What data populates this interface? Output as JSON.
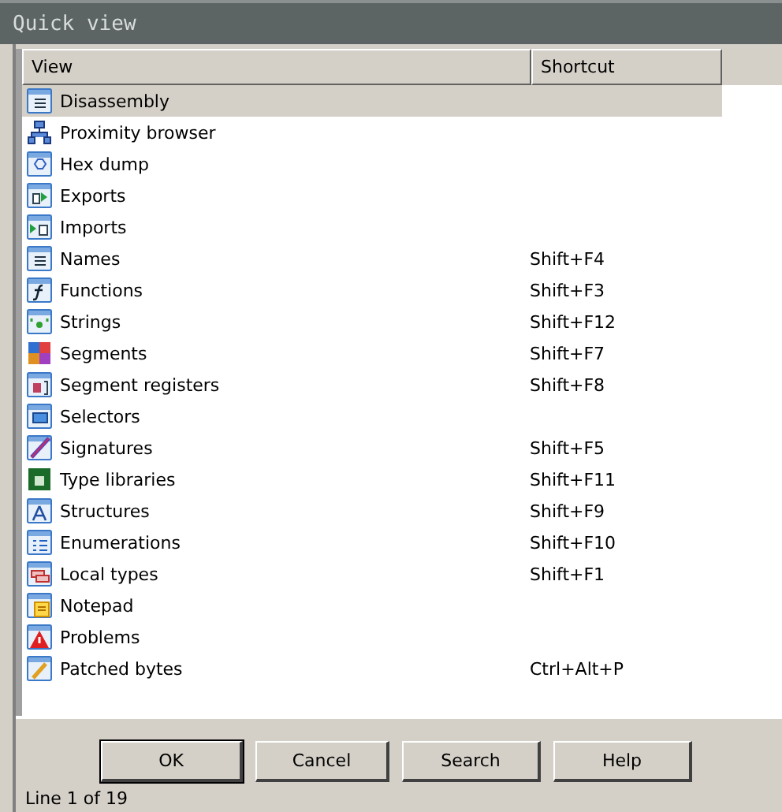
{
  "window": {
    "title": "Quick view"
  },
  "table": {
    "columns": [
      "View",
      "Shortcut"
    ],
    "rows": [
      {
        "view": "Disassembly",
        "shortcut": "",
        "selected": true
      },
      {
        "view": "Proximity browser",
        "shortcut": "",
        "selected": false
      },
      {
        "view": "Hex dump",
        "shortcut": "",
        "selected": false
      },
      {
        "view": "Exports",
        "shortcut": "",
        "selected": false
      },
      {
        "view": "Imports",
        "shortcut": "",
        "selected": false
      },
      {
        "view": "Names",
        "shortcut": "Shift+F4",
        "selected": false
      },
      {
        "view": "Functions",
        "shortcut": "Shift+F3",
        "selected": false
      },
      {
        "view": "Strings",
        "shortcut": "Shift+F12",
        "selected": false
      },
      {
        "view": "Segments",
        "shortcut": "Shift+F7",
        "selected": false
      },
      {
        "view": "Segment registers",
        "shortcut": "Shift+F8",
        "selected": false
      },
      {
        "view": "Selectors",
        "shortcut": "",
        "selected": false
      },
      {
        "view": "Signatures",
        "shortcut": "Shift+F5",
        "selected": false
      },
      {
        "view": "Type libraries",
        "shortcut": "Shift+F11",
        "selected": false
      },
      {
        "view": "Structures",
        "shortcut": "Shift+F9",
        "selected": false
      },
      {
        "view": "Enumerations",
        "shortcut": "Shift+F10",
        "selected": false
      },
      {
        "view": "Local types",
        "shortcut": "Shift+F1",
        "selected": false
      },
      {
        "view": "Notepad",
        "shortcut": "",
        "selected": false
      },
      {
        "view": "Problems",
        "shortcut": "",
        "selected": false
      },
      {
        "view": "Patched bytes",
        "shortcut": "Ctrl+Alt+P",
        "selected": false
      }
    ]
  },
  "buttons": [
    "OK",
    "Cancel",
    "Search",
    "Help"
  ],
  "status_bar": "Line 1 of 19"
}
